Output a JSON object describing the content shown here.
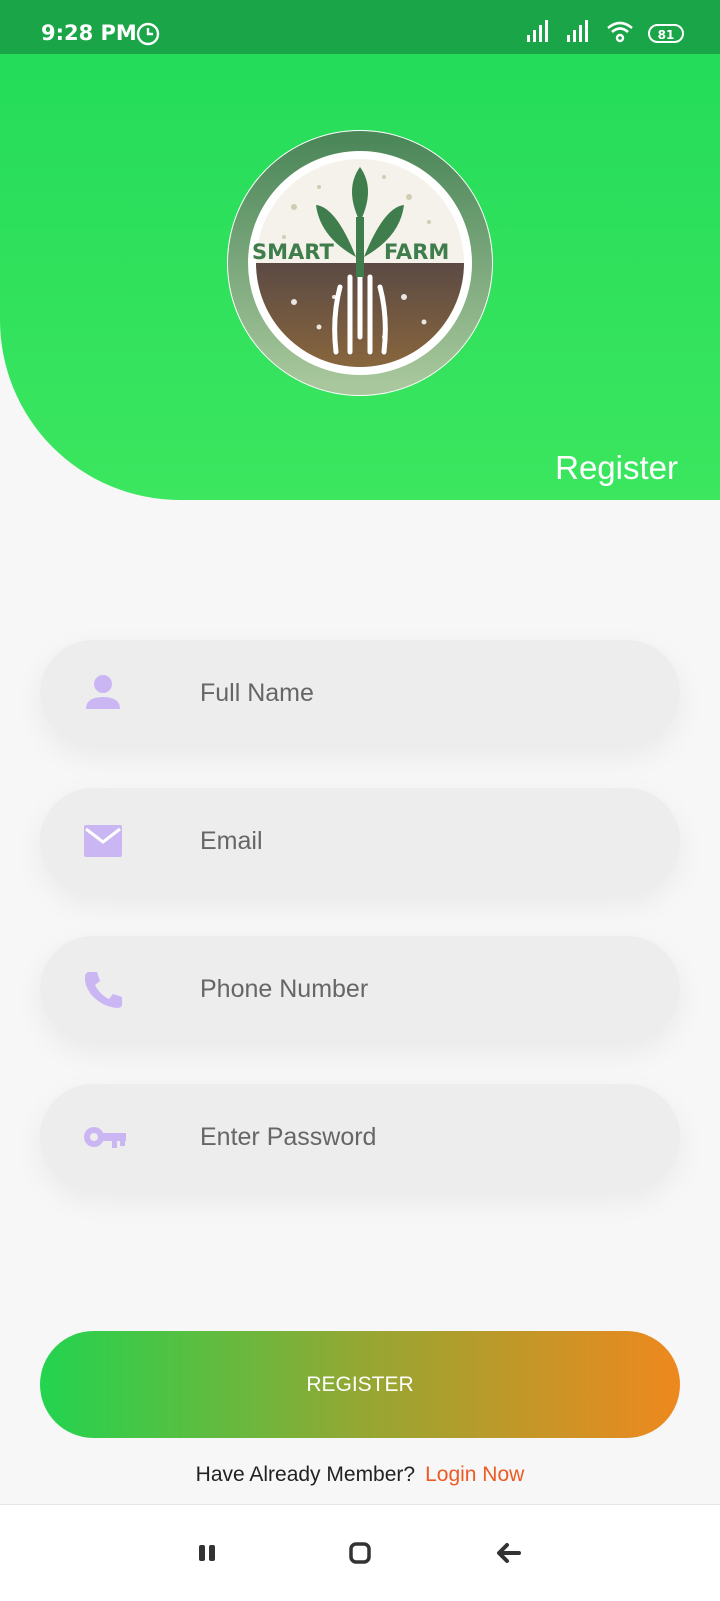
{
  "status_bar": {
    "time": "9:28 PM",
    "battery": "81"
  },
  "logo": {
    "left_word": "SMART",
    "right_word": "FARM"
  },
  "header": {
    "title": "Register"
  },
  "form": {
    "full_name_placeholder": "Full Name",
    "email_placeholder": "Email",
    "phone_placeholder": "Phone Number",
    "password_placeholder": "Enter Password"
  },
  "register_button": {
    "label": "REGISTER"
  },
  "footer": {
    "prompt": "Have Already Member?",
    "login_link": "Login Now"
  },
  "icons": {
    "name_field": "person-icon",
    "email_field": "mail-icon",
    "phone_field": "phone-icon",
    "password_field": "key-icon",
    "nav_recent": "recent-apps-icon",
    "nav_home": "home-icon",
    "nav_back": "back-icon"
  },
  "colors": {
    "header_green": "#28de5a",
    "status_bar": "#1aa548",
    "field_icon": "#cbb6f4",
    "link_orange": "#ee5a24",
    "button_gradient": [
      "#22d44f",
      "#ee881e"
    ]
  }
}
